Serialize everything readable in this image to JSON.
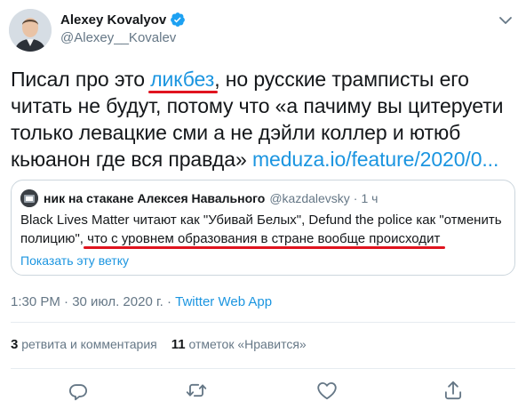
{
  "author": {
    "display_name": "Alexey Kovalyov",
    "handle": "@Alexey__Kovalev",
    "verified_icon": "verified-badge-icon"
  },
  "tweet": {
    "text_before_underline": "Писал про это ",
    "underlined_word": "ликбез",
    "text_after_underline": ", но русские трамписты его читать не будут, потому что «а пачиму вы цитеруети только левацкие сми а не дэйли коллер и ютюб кьюанон где вся правда» ",
    "link": "meduza.io/feature/2020/0..."
  },
  "quote": {
    "name": "ник на стакане Алексея Навального",
    "handle": "@kazdalevsky",
    "separator": "·",
    "time": "1 ч",
    "body_before": "Black Lives Matter читают как \"Убивай Белых\", Defund the police как \"отменить полицию\", ",
    "body_underlined": "что с уровнем образования в стране вообще происходит",
    "show_thread": "Показать эту ветку"
  },
  "meta": {
    "time": "1:30 PM · 30 июл. 2020 г.",
    "separator": " · ",
    "source": "Twitter Web App"
  },
  "stats": {
    "retweets_count": "3",
    "retweets_label": " ретвита и комментария",
    "likes_count": "11",
    "likes_label": " отметок «Нравится»"
  },
  "colors": {
    "link": "#1b95e0",
    "annotation_red": "#e0141f",
    "secondary_text": "#657786"
  }
}
